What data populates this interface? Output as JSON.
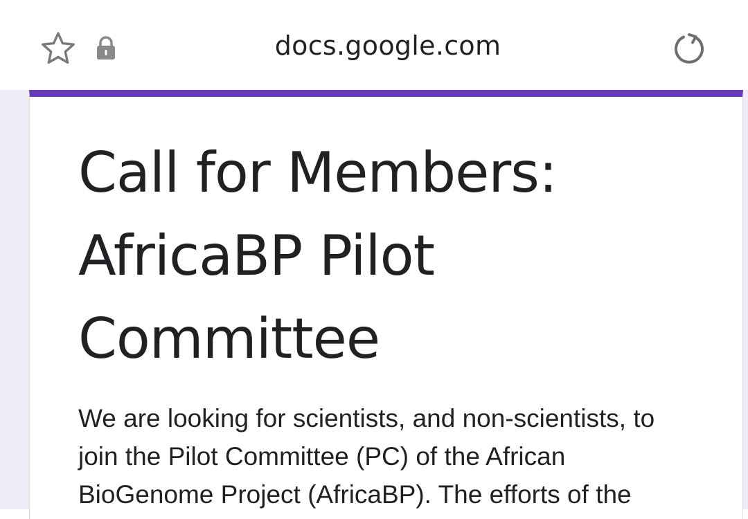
{
  "browser": {
    "url": "docs.google.com",
    "icons": {
      "bookmark": "star-outline-icon",
      "security": "lock-icon",
      "reload": "reload-icon"
    }
  },
  "form": {
    "accent_color": "#673ab7",
    "background_color": "#f0ebf8",
    "title": "Call for Members: AfricaBP Pilot Committee",
    "description": "We are looking for scientists, and non-scientists, to join the Pilot Committee (PC) of the African BioGenome Project (AfricaBP). The efforts of the"
  }
}
